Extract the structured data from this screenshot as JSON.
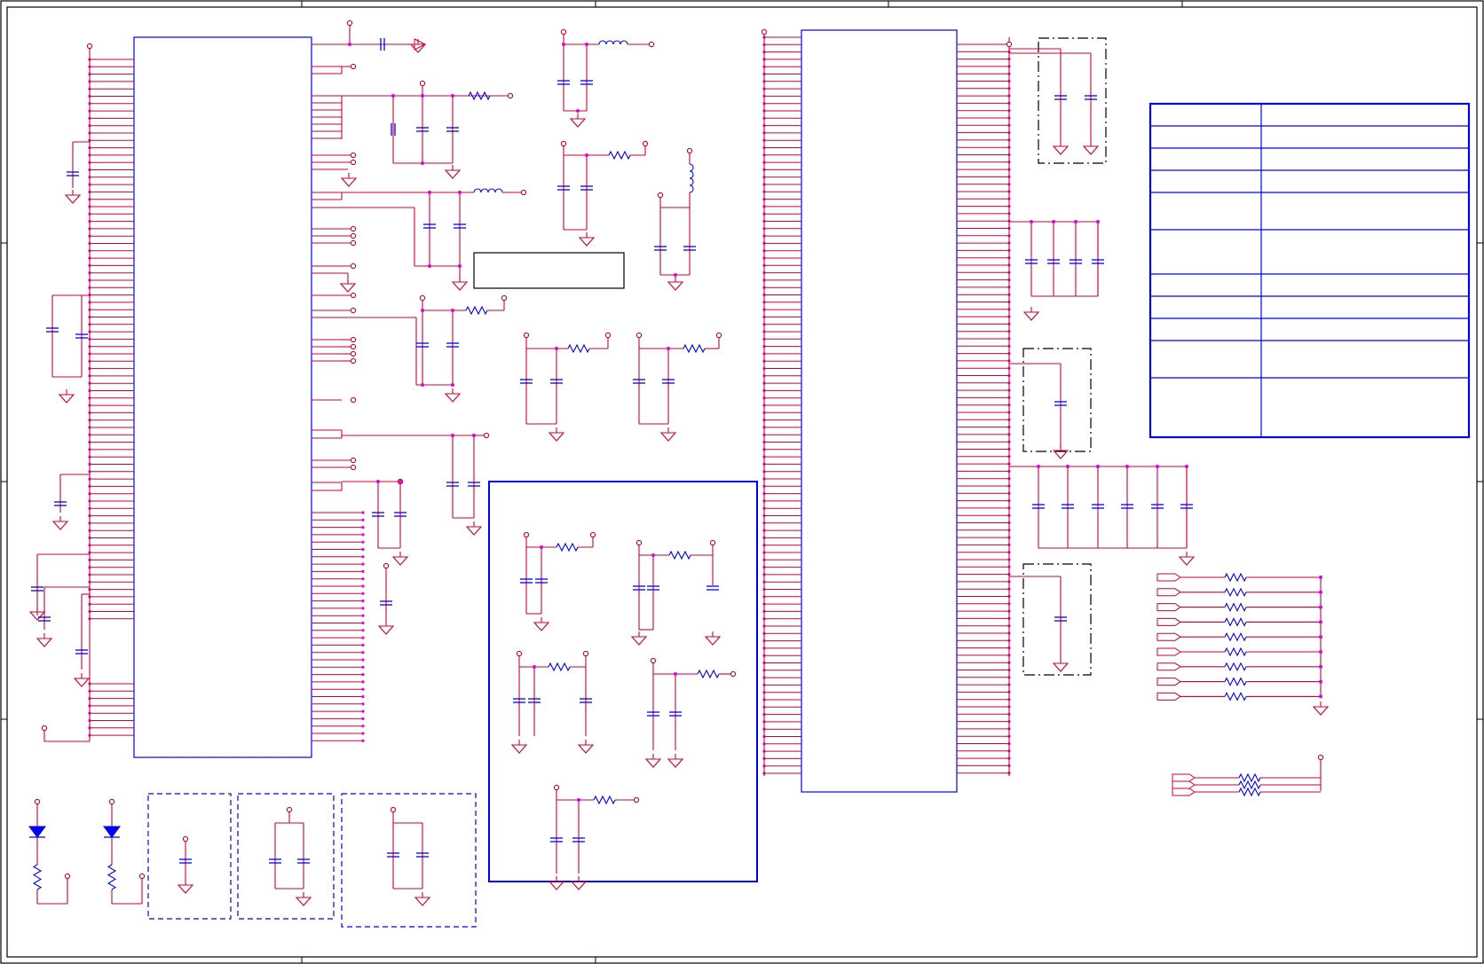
{
  "sheet": {
    "title_block_text": ""
  },
  "colors": {
    "wire": "#cc0033",
    "net": "#cc0033",
    "junction": "#e000e0",
    "component": "#0000ee",
    "border": "#000000",
    "dashed": "#000000"
  },
  "icons": {
    "capacitor": "capacitor-icon",
    "resistor": "resistor-icon",
    "inductor": "inductor-icon",
    "ground": "ground-icon",
    "led": "led-icon",
    "port": "port-icon"
  }
}
